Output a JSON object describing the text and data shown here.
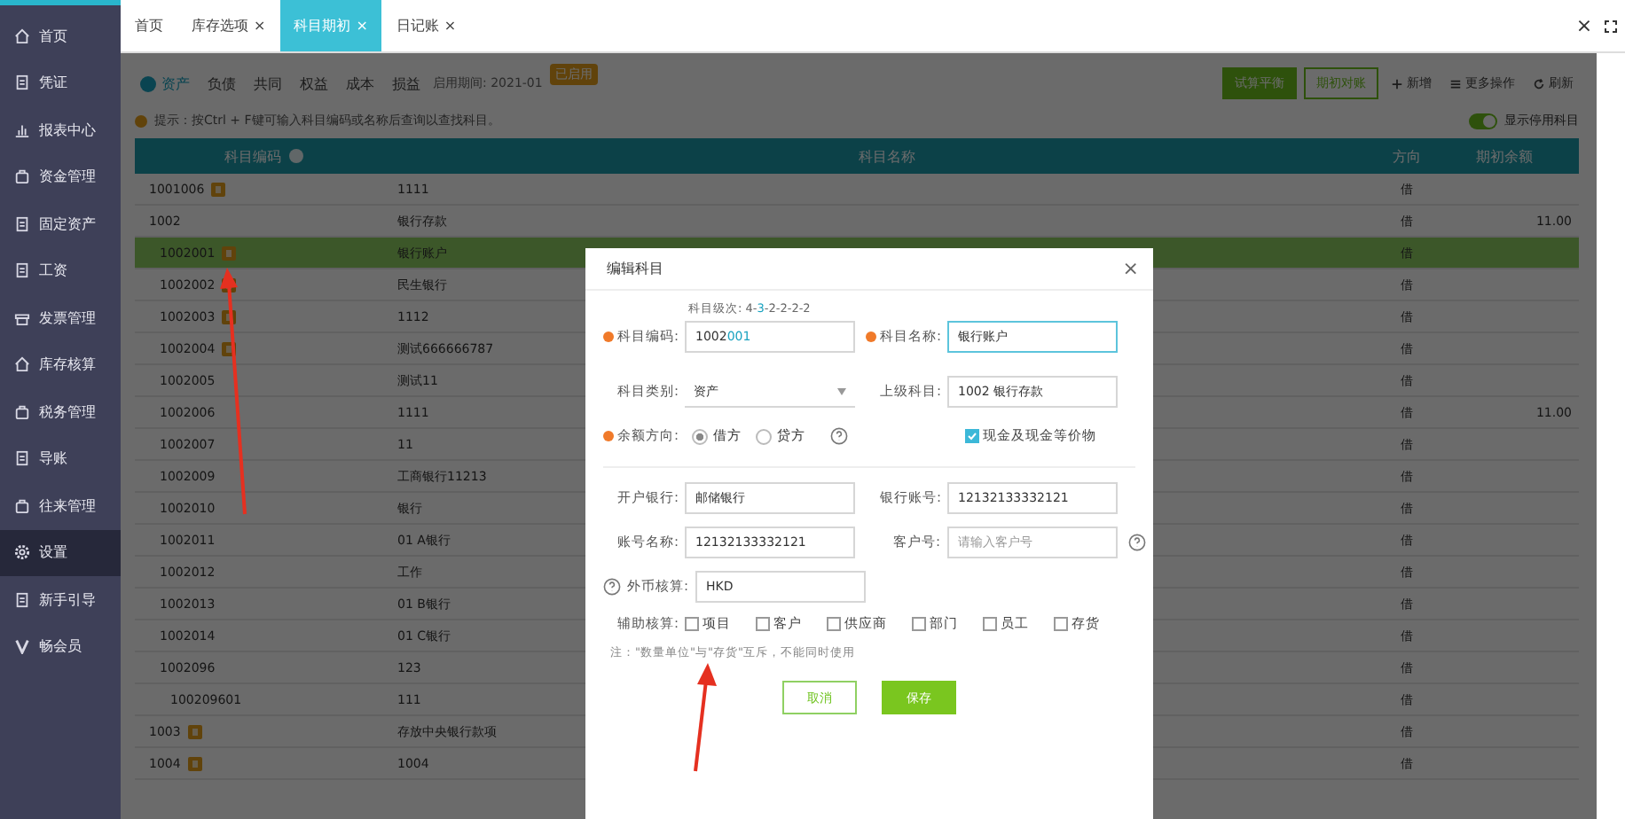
{
  "sidebar": {
    "items": [
      {
        "label": "首页",
        "selected": false
      },
      {
        "label": "凭证",
        "selected": false
      },
      {
        "label": "报表中心",
        "selected": false
      },
      {
        "label": "资金管理",
        "selected": false
      },
      {
        "label": "固定资产",
        "selected": false
      },
      {
        "label": "工资",
        "selected": false
      },
      {
        "label": "发票管理",
        "selected": false
      },
      {
        "label": "库存核算",
        "selected": false
      },
      {
        "label": "税务管理",
        "selected": false
      },
      {
        "label": "导账",
        "selected": false
      },
      {
        "label": "往来管理",
        "selected": false
      },
      {
        "label": "设置",
        "selected": true
      },
      {
        "label": "新手引导",
        "selected": false
      },
      {
        "label": "畅会员",
        "selected": false
      }
    ]
  },
  "tabs": [
    {
      "label": "首页",
      "selected": false
    },
    {
      "label": "库存选项",
      "close": "×",
      "selected": false
    },
    {
      "label": "科目期初",
      "close": "×",
      "selected": true
    },
    {
      "label": "日记账",
      "close": "×",
      "selected": false
    }
  ],
  "window_controls": {
    "close": "×"
  },
  "toolbar": {
    "categories": [
      {
        "label": "资产",
        "selected": true
      },
      {
        "label": "负债",
        "selected": false
      },
      {
        "label": "共同",
        "selected": false
      },
      {
        "label": "权益",
        "selected": false
      },
      {
        "label": "成本",
        "selected": false
      },
      {
        "label": "损益",
        "selected": false
      }
    ],
    "period": "启用期间: 2021-01",
    "status_badge": "已启用",
    "primary_button": "试算平衡",
    "secondary_button": "期初对账",
    "actions": [
      "新增",
      "更多操作",
      "刷新"
    ],
    "toggle": {
      "label": "显示停用科目",
      "on": true
    }
  },
  "tip": "提示：按Ctrl + F键可输入科目编码或名称后查询以查找科目。",
  "table": {
    "columns": [
      "科目编码",
      "科目名称",
      "方向",
      "期初余额"
    ],
    "rows": [
      {
        "code": "1001006",
        "flag": true,
        "name": "1111",
        "direction": "借",
        "selected": false
      },
      {
        "code": "1002",
        "flag": false,
        "name": "银行存款",
        "direction": "借",
        "balance": "11.00",
        "selected": false,
        "children": [
          {
            "code": "1002001",
            "flag": true,
            "name": "银行账户",
            "direction": "借",
            "selected": true
          },
          {
            "code": "1002002",
            "flag": true,
            "name": "民生银行",
            "direction": "借",
            "selected": false
          },
          {
            "code": "1002003",
            "flag": true,
            "name": "1112",
            "direction": "借",
            "selected": false
          },
          {
            "code": "1002004",
            "flag": true,
            "name": "测试666666787",
            "direction": "借",
            "selected": false
          },
          {
            "code": "1002005",
            "flag": false,
            "name": "测试11",
            "direction": "借",
            "selected": false
          },
          {
            "code": "1002006",
            "flag": false,
            "name": "1111",
            "direction": "借",
            "balance": "11.00",
            "selected": false
          },
          {
            "code": "1002007",
            "flag": false,
            "name": "11",
            "direction": "借",
            "selected": false
          },
          {
            "code": "1002009",
            "flag": false,
            "name": "工商银行11213",
            "direction": "借",
            "selected": false
          },
          {
            "code": "1002010",
            "flag": false,
            "name": "银行",
            "direction": "借",
            "selected": false
          },
          {
            "code": "1002011",
            "flag": false,
            "name": "01 A银行",
            "direction": "借",
            "selected": false
          },
          {
            "code": "1002012",
            "flag": false,
            "name": "工作",
            "direction": "借",
            "selected": false
          },
          {
            "code": "1002013",
            "flag": false,
            "name": "01 B银行",
            "direction": "借",
            "selected": false
          },
          {
            "code": "1002014",
            "flag": false,
            "name": "01 C银行",
            "direction": "借",
            "selected": false
          },
          {
            "code": "1002096",
            "flag": false,
            "name": "123",
            "direction": "借",
            "selected": false,
            "children": [
              {
                "code": "100209601",
                "flag": false,
                "name": "111",
                "direction": "借",
                "selected": false
              }
            ]
          }
        ]
      },
      {
        "code": "1003",
        "flag": true,
        "name": "存放中央银行款项",
        "direction": "借",
        "selected": false
      },
      {
        "code": "1004",
        "flag": true,
        "name": "1004",
        "direction": "借",
        "selected": false
      }
    ]
  },
  "dialog": {
    "title": "编辑科目",
    "close": "×",
    "level_hint": {
      "label": "科目级次: ",
      "prefix": "4-",
      "current": "3",
      "suffix": "-2-2-2-2"
    },
    "code": {
      "label": "科目编码:",
      "required": true,
      "parent": "1002",
      "own": "001"
    },
    "name": {
      "label": "科目名称:",
      "required": true,
      "value": "银行账户"
    },
    "category": {
      "label": "科目类别:",
      "value": "资产"
    },
    "parent": {
      "label": "上级科目:",
      "value": "1002 银行存款"
    },
    "direction": {
      "label": "余额方向:",
      "required": true,
      "options": [
        {
          "label": "借方",
          "selected": true
        },
        {
          "label": "贷方",
          "selected": false
        }
      ]
    },
    "cash_equivalent": {
      "label": "现金及现金等价物",
      "checked": true
    },
    "bank_fields": [
      {
        "label": "开户银行:",
        "value": "邮储银行"
      },
      {
        "label": "银行账号:",
        "value": "12132133332121"
      },
      {
        "label": "账号名称:",
        "value": "12132133332121"
      },
      {
        "label": "客户号:",
        "placeholder": "请输入客户号",
        "help": true
      }
    ],
    "currency": {
      "label": "外币核算:",
      "value": "HKD"
    },
    "auxiliary": {
      "label": "辅助核算:",
      "options": [
        {
          "label": "项目",
          "checked": false
        },
        {
          "label": "客户",
          "checked": false
        },
        {
          "label": "供应商",
          "checked": false
        },
        {
          "label": "部门",
          "checked": false
        },
        {
          "label": "员工",
          "checked": false
        },
        {
          "label": "存货",
          "checked": false
        }
      ]
    },
    "note": "注：\"数量单位\"与\"存货\"互斥，不能同时使用",
    "buttons": [
      {
        "label": "取消",
        "kind": "secondary"
      },
      {
        "label": "保存",
        "kind": "primary"
      }
    ]
  }
}
